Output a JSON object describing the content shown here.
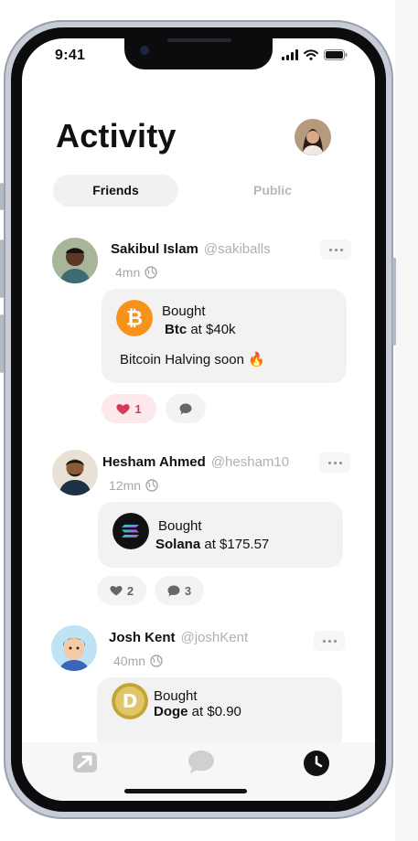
{
  "status_bar": {
    "time": "9:41"
  },
  "header": {
    "title": "Activity"
  },
  "tabs": [
    {
      "label": "Friends",
      "active": true
    },
    {
      "label": "Public",
      "active": false
    }
  ],
  "feed": [
    {
      "name": "Sakibul Islam",
      "handle": "@sakiballs",
      "time": "4mn",
      "action": "Bought",
      "asset": "Btc",
      "price_text": "at $40k",
      "note": "Bitcoin Halving soon",
      "note_emoji": "🔥",
      "likes": "1",
      "comments": "",
      "liked": true
    },
    {
      "name": "Hesham Ahmed",
      "handle": "@hesham10",
      "time": "12mn",
      "action": "Bought",
      "asset": "Solana",
      "price_text": "at $175.57",
      "likes": "2",
      "comments": "3",
      "liked": false
    },
    {
      "name": "Josh Kent",
      "handle": "@joshKent",
      "time": "40mn",
      "action": "Bought",
      "asset": "Doge",
      "price_text": "at $0.90"
    }
  ],
  "colors": {
    "btc": "#f7931a",
    "like": "#d23a55",
    "like_bg": "#fde9ec",
    "card_bg": "#f2f2f2",
    "muted": "#a7a7a7"
  },
  "icons": [
    "signal-icon",
    "wifi-icon",
    "battery-icon",
    "globe-icon",
    "more-icon",
    "heart-icon",
    "comment-icon",
    "trade-icon",
    "chat-icon",
    "clock-icon"
  ]
}
